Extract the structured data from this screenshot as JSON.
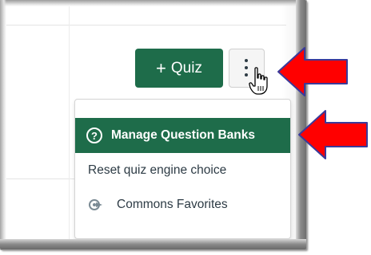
{
  "toolbar": {
    "add_quiz_plus": "+",
    "add_quiz_label": "Quiz",
    "more_options_icon": "kebab-vertical-icon"
  },
  "menu": {
    "items": [
      {
        "label": "Manage Question Banks",
        "icon": "question-circle-icon",
        "state": "highlighted"
      },
      {
        "label": "Reset quiz engine choice",
        "icon": ""
      },
      {
        "label": "Commons Favorites",
        "icon": "commons-share-icon"
      }
    ]
  },
  "colors": {
    "primary_green": "#1e6c4a",
    "annotation_arrow": "#ff0000",
    "text": "#2d3b45"
  }
}
